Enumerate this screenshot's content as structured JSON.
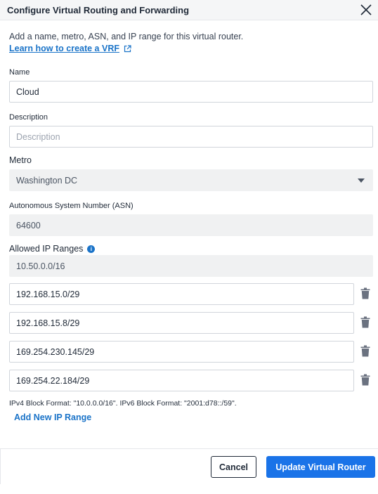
{
  "dialog": {
    "title": "Configure Virtual Routing and Forwarding",
    "intro": "Add a name, metro, ASN, and IP range for this virtual router.",
    "learn_link": "Learn how to create a VRF"
  },
  "form": {
    "name": {
      "label": "Name",
      "value": "Cloud"
    },
    "description": {
      "label": "Description",
      "placeholder": "Description",
      "value": ""
    },
    "metro": {
      "label": "Metro",
      "selected": "Washington DC"
    },
    "asn": {
      "label": "Autonomous System Number (ASN)",
      "value": "64600"
    },
    "allowed_ip_ranges": {
      "label": "Allowed IP Ranges",
      "base_range": "10.50.0.0/16",
      "ranges": [
        "192.168.15.0/29",
        "192.168.15.8/29",
        "169.254.230.145/29",
        "169.254.22.184/29"
      ],
      "hint": "IPv4 Block Format: \"10.0.0.0/16\". IPv6 Block Format: \"2001:d78::/59\".",
      "add_label": "Add New IP Range"
    }
  },
  "footer": {
    "cancel_label": "Cancel",
    "submit_label": "Update Virtual Router"
  },
  "colors": {
    "accent": "#1a73e8",
    "link": "#1a73c8",
    "disabled_bg": "#f0f1f2",
    "header_bg": "#f5f6f7"
  },
  "icons": {
    "close": "close-icon",
    "external_link": "external-link-icon",
    "info": "info-icon",
    "trash": "trash-icon",
    "dropdown": "chevron-down-icon"
  }
}
